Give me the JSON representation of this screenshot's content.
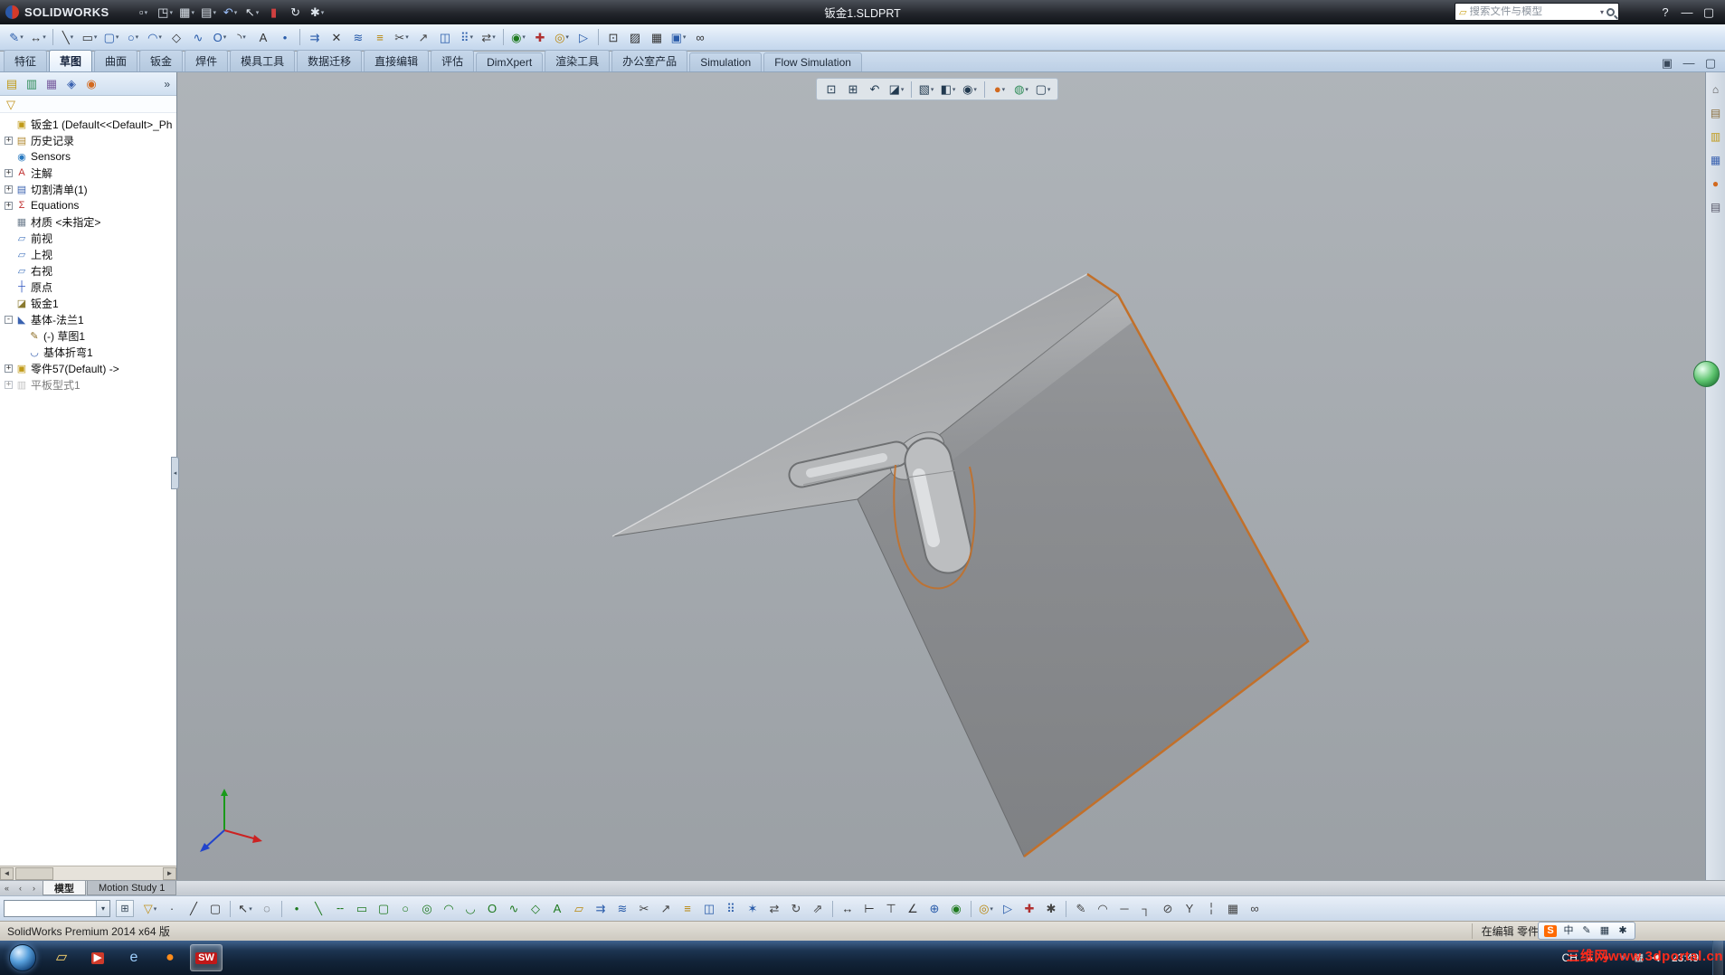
{
  "colors": {
    "selection_edge_orange": "#c2702a",
    "viewport_background": "#a6abb0",
    "taskbar_blue": "#1d3552",
    "watermark_red": "#ff2a1a",
    "active_tab_background": "#eef5fc"
  },
  "titlebar": {
    "brand": "SOLIDWORKS",
    "title": "钣金1.SLDPRT",
    "search_placeholder": "搜索文件与模型",
    "search_scope_glyph": "▱",
    "search_arrow": "▾",
    "tools": [
      {
        "n": "new-document-button",
        "g": "▫",
        "c": "#dfe6ee",
        "dd": 1
      },
      {
        "n": "open-button",
        "g": "◳",
        "c": "#dfe6ee",
        "dd": 1
      },
      {
        "n": "save-button",
        "g": "▦",
        "c": "#dfe6ee",
        "dd": 1
      },
      {
        "n": "print-button",
        "g": "▤",
        "c": "#dfe6ee",
        "dd": 1
      },
      {
        "n": "undo-button",
        "g": "↶",
        "c": "#9fc3ff",
        "dd": 1
      },
      {
        "n": "select-button",
        "g": "↖",
        "c": "#dfe6ee",
        "dd": 1
      },
      {
        "n": "file-properties-button",
        "g": "▮",
        "c": "#d04040"
      },
      {
        "n": "rebuild-button",
        "g": "↻",
        "c": "#dfe6ee"
      },
      {
        "n": "options-button",
        "g": "✱",
        "c": "#dfe6ee",
        "dd": 1
      }
    ],
    "window_buttons": [
      {
        "n": "help-button",
        "g": "?",
        "c": "#e8ecf2"
      },
      {
        "n": "minimize-button",
        "g": "—",
        "c": "#e8ecf2"
      },
      {
        "n": "restore-button",
        "g": "▢",
        "c": "#e8ecf2"
      }
    ]
  },
  "toolbars": {
    "sketch": [
      {
        "n": "sketch-button",
        "g": "✎",
        "c": "#2a5caa",
        "dd": 1
      },
      {
        "n": "smart-dimension-button",
        "g": "↔",
        "c": "#333",
        "dd": 1
      },
      {
        "sep": 1
      },
      {
        "n": "line-tool",
        "g": "╲",
        "c": "#333",
        "dd": 1
      },
      {
        "n": "rectangle-tool",
        "g": "▭",
        "c": "#333",
        "dd": 1
      },
      {
        "n": "slot-tool",
        "g": "▢",
        "c": "#2a5caa",
        "dd": 1
      },
      {
        "n": "circle-tool",
        "g": "○",
        "c": "#2a5caa",
        "dd": 1
      },
      {
        "n": "arc-tool",
        "g": "◠",
        "c": "#2a5caa",
        "dd": 1
      },
      {
        "n": "polygon-tool",
        "g": "◇",
        "c": "#333"
      },
      {
        "n": "spline-tool",
        "g": "∿",
        "c": "#2a5caa"
      },
      {
        "n": "ellipse-tool",
        "g": "O",
        "c": "#2a5caa",
        "dd": 1
      },
      {
        "n": "fillet-tool",
        "g": "◝",
        "c": "#333",
        "dd": 1
      },
      {
        "n": "text-tool",
        "g": "A",
        "c": "#333"
      },
      {
        "n": "point-tool",
        "g": "•",
        "c": "#2a5caa"
      },
      {
        "sep": 1
      },
      {
        "n": "convert-entities-button",
        "g": "⇉",
        "c": "#2a5caa"
      },
      {
        "n": "intersection-curve-button",
        "g": "✕",
        "c": "#333"
      },
      {
        "n": "face-curves-button",
        "g": "≋",
        "c": "#2a5caa"
      },
      {
        "n": "offset-entities-button",
        "g": "≡",
        "c": "#b8860b"
      },
      {
        "n": "trim-entities-button",
        "g": "✂",
        "c": "#444",
        "dd": 1
      },
      {
        "n": "extend-entities-button",
        "g": "↗",
        "c": "#444"
      },
      {
        "n": "mirror-entities-button",
        "g": "◫",
        "c": "#2a5caa"
      },
      {
        "n": "linear-sketch-pattern-button",
        "g": "⠿",
        "c": "#2a5caa",
        "dd": 1
      },
      {
        "n": "move-entities-button",
        "g": "⇄",
        "c": "#444",
        "dd": 1
      },
      {
        "sep": 1
      },
      {
        "n": "display-delete-relations-button",
        "g": "◉",
        "c": "#1f7a1f",
        "dd": 1
      },
      {
        "n": "repair-sketch-button",
        "g": "✚",
        "c": "#b03030"
      },
      {
        "n": "quick-snaps-button",
        "g": "◎",
        "c": "#b8860b",
        "dd": 1
      },
      {
        "n": "rapid-sketch-button",
        "g": "▷",
        "c": "#2a5caa"
      },
      {
        "sep": 1
      },
      {
        "n": "instant2d-button",
        "g": "⊡",
        "c": "#333"
      },
      {
        "n": "shaded-sketch-contours-button",
        "g": "▨",
        "c": "#333"
      },
      {
        "n": "sketch-picture-button",
        "g": "▦",
        "c": "#333"
      },
      {
        "n": "make-block-button",
        "g": "▣",
        "c": "#2a5caa",
        "dd": 1
      },
      {
        "n": "belt-chain-button",
        "g": "∞",
        "c": "#333"
      }
    ],
    "heads_up": [
      {
        "n": "zoom-to-fit-button",
        "g": "⊡",
        "c": "#223a50"
      },
      {
        "n": "zoom-to-area-button",
        "g": "⊞",
        "c": "#223a50"
      },
      {
        "n": "previous-view-button",
        "g": "↶",
        "c": "#223a50"
      },
      {
        "n": "section-view-button",
        "g": "◪",
        "c": "#223a50",
        "dd": 1
      },
      {
        "sep": 1
      },
      {
        "n": "view-orientation-button",
        "g": "▧",
        "c": "#223a50",
        "dd": 1
      },
      {
        "n": "display-style-button",
        "g": "◧",
        "c": "#223a50",
        "dd": 1
      },
      {
        "n": "hide-show-items-button",
        "g": "◉",
        "c": "#223a50",
        "dd": 1
      },
      {
        "sep": 1
      },
      {
        "n": "edit-appearance-button",
        "g": "●",
        "c": "#d2691e",
        "dd": 1
      },
      {
        "n": "apply-scene-button",
        "g": "◍",
        "c": "#2e8b57",
        "dd": 1
      },
      {
        "n": "view-settings-button",
        "g": "▢",
        "c": "#223a50",
        "dd": 1
      }
    ],
    "cmd_right": [
      {
        "n": "pin-commandmanager-button",
        "g": "▣",
        "c": "#3a4a5c"
      },
      {
        "n": "document-minimize-button",
        "g": "—",
        "c": "#3a4a5c"
      },
      {
        "n": "document-restore-button",
        "g": "▢",
        "c": "#3a4a5c"
      }
    ],
    "task_pane": [
      {
        "n": "solidworks-resources-icon",
        "g": "⌂",
        "c": "#555"
      },
      {
        "n": "design-library-icon",
        "g": "▤",
        "c": "#8a6d3b"
      },
      {
        "n": "file-explorer-icon",
        "g": "▥",
        "c": "#c09a18"
      },
      {
        "n": "view-palette-icon",
        "g": "▦",
        "c": "#3a62b0"
      },
      {
        "n": "appearances-icon",
        "g": "●",
        "c": "#d2691e"
      },
      {
        "n": "custom-properties-icon",
        "g": "▤",
        "c": "#556"
      }
    ]
  },
  "command_tabs": [
    {
      "label": "特征",
      "n": "tab-features"
    },
    {
      "label": "草图",
      "n": "tab-sketch",
      "active": 1
    },
    {
      "label": "曲面",
      "n": "tab-surfaces"
    },
    {
      "label": "钣金",
      "n": "tab-sheet-metal"
    },
    {
      "label": "焊件",
      "n": "tab-weldments"
    },
    {
      "label": "模具工具",
      "n": "tab-mold-tools"
    },
    {
      "label": "数据迁移",
      "n": "tab-data-migration"
    },
    {
      "label": "直接编辑",
      "n": "tab-direct-editing"
    },
    {
      "label": "评估",
      "n": "tab-evaluate"
    },
    {
      "label": "DimXpert",
      "n": "tab-dimxpert"
    },
    {
      "label": "渲染工具",
      "n": "tab-render-tools"
    },
    {
      "label": "办公室产品",
      "n": "tab-office-products"
    },
    {
      "label": "Simulation",
      "n": "tab-simulation"
    },
    {
      "label": "Flow Simulation",
      "n": "tab-flow-simulation"
    }
  ],
  "panel": {
    "tabs": [
      {
        "n": "featuremanager-tab",
        "g": "▤",
        "c": "#c09a18"
      },
      {
        "n": "propertymanager-tab",
        "g": "▥",
        "c": "#2e8b57"
      },
      {
        "n": "configurationmanager-tab",
        "g": "▦",
        "c": "#7a5fa0"
      },
      {
        "n": "dimxpertmanager-tab",
        "g": "◈",
        "c": "#3a62b0"
      },
      {
        "n": "displaymanager-tab",
        "g": "◉",
        "c": "#d2691e"
      }
    ],
    "more_glyph": "»",
    "filter": [
      {
        "n": "tree-filter-icon",
        "g": "▽",
        "c": "#c09018"
      }
    ],
    "hscroll_left": "◄",
    "hscroll_right": "►",
    "collapse_glyph": "◂"
  },
  "feature_tree": {
    "items": [
      {
        "n": "tree-root-part",
        "icon": "▣",
        "icon_color": "#c09a18",
        "label": "钣金1 (Default<<Default>_Ph"
      },
      {
        "n": "tree-item-history",
        "expand": "+",
        "icon": "▤",
        "icon_color": "#b08830",
        "label": "历史记录"
      },
      {
        "n": "tree-item-sensors",
        "icon": "◉",
        "icon_color": "#2a7ac0",
        "label": "Sensors"
      },
      {
        "n": "tree-item-annotations",
        "expand": "+",
        "icon": "A",
        "icon_color": "#c03030",
        "label": "注解"
      },
      {
        "n": "tree-item-cutlist",
        "expand": "+",
        "icon": "▤",
        "icon_color": "#3a62b0",
        "label": "切割清单(1)"
      },
      {
        "n": "tree-item-equations",
        "expand": "+",
        "icon": "Σ",
        "icon_color": "#c03030",
        "label": "Equations"
      },
      {
        "n": "tree-item-material",
        "icon": "▦",
        "icon_color": "#708090",
        "label": "材质 <未指定>"
      },
      {
        "n": "tree-item-front-plane",
        "icon": "▱",
        "icon_color": "#4a7ac0",
        "label": "前视"
      },
      {
        "n": "tree-item-top-plane",
        "icon": "▱",
        "icon_color": "#4a7ac0",
        "label": "上视"
      },
      {
        "n": "tree-item-right-plane",
        "icon": "▱",
        "icon_color": "#4a7ac0",
        "label": "右视"
      },
      {
        "n": "tree-item-origin",
        "icon": "┼",
        "icon_color": "#2a52be",
        "label": "原点"
      },
      {
        "n": "tree-item-sheet-metal",
        "icon": "◪",
        "icon_color": "#8a7a30",
        "label": "钣金1"
      },
      {
        "n": "tree-item-base-flange",
        "expand": "-",
        "icon": "◣",
        "icon_color": "#3a62b0",
        "label": "基体-法兰1"
      },
      {
        "n": "tree-item-sketch1",
        "indent": 1,
        "icon": "✎",
        "icon_color": "#8a6a20",
        "label": "(-) 草图1"
      },
      {
        "n": "tree-item-base-bend",
        "indent": 1,
        "icon": "◡",
        "icon_color": "#3a62b0",
        "label": "基体折弯1"
      },
      {
        "n": "tree-item-part57",
        "expand": "+",
        "icon": "▣",
        "icon_color": "#c09a18",
        "label": "零件57(Default) ->"
      },
      {
        "n": "tree-item-flat-pattern",
        "expand": "+",
        "icon": "▥",
        "icon_color": "#909090",
        "label": "平板型式1",
        "grayed": 1
      }
    ]
  },
  "bottom_tabs": {
    "scroll_buttons": [
      {
        "n": "tabs-scroll-start-button",
        "g": "«",
        "c": "#444"
      },
      {
        "n": "tabs-scroll-left-button",
        "g": "‹",
        "c": "#444"
      },
      {
        "n": "tabs-scroll-right-button",
        "g": "›",
        "c": "#444"
      }
    ],
    "tabs": [
      {
        "label": "模型",
        "n": "tab-model",
        "active": 1
      },
      {
        "label": "Motion Study 1",
        "n": "tab-motion-study-1"
      }
    ]
  },
  "bottom_toolbar": {
    "combo_value": "",
    "combo_arrow": "▾",
    "expand_glyph": "⊞",
    "icons": [
      {
        "n": "selection-filter-button",
        "g": "▽",
        "c": "#c09018",
        "dd": 1
      },
      {
        "n": "filter-vertices-button",
        "g": "·",
        "c": "#333"
      },
      {
        "n": "filter-edges-button",
        "g": "╱",
        "c": "#333"
      },
      {
        "n": "filter-faces-button",
        "g": "▢",
        "c": "#333"
      },
      {
        "sep": 1
      },
      {
        "n": "select-arrow-button",
        "g": "↖",
        "c": "#333",
        "dd": 1
      },
      {
        "n": "lasso-select-button",
        "g": "◌",
        "c": "#333"
      },
      {
        "sep": 1
      },
      {
        "n": "sketch-point-tool",
        "g": "•",
        "c": "#1f7a1f"
      },
      {
        "n": "sketch-line-tool",
        "g": "╲",
        "c": "#1f7a1f"
      },
      {
        "n": "sketch-centerline-tool",
        "g": "╌",
        "c": "#1f7a1f"
      },
      {
        "n": "sketch-rectangle-tool",
        "g": "▭",
        "c": "#1f7a1f"
      },
      {
        "n": "sketch-center-rectangle-tool",
        "g": "▢",
        "c": "#1f7a1f"
      },
      {
        "n": "sketch-circle-tool",
        "g": "○",
        "c": "#1f7a1f"
      },
      {
        "n": "sketch-perimeter-circle-tool",
        "g": "◎",
        "c": "#1f7a1f"
      },
      {
        "n": "sketch-arc-tool",
        "g": "◠",
        "c": "#1f7a1f"
      },
      {
        "n": "sketch-tangent-arc-tool",
        "g": "◡",
        "c": "#1f7a1f"
      },
      {
        "n": "sketch-ellipse-tool",
        "g": "O",
        "c": "#1f7a1f"
      },
      {
        "n": "sketch-spline-tool",
        "g": "∿",
        "c": "#1f7a1f"
      },
      {
        "n": "sketch-polygon-tool",
        "g": "◇",
        "c": "#1f7a1f"
      },
      {
        "n": "sketch-text-tool",
        "g": "A",
        "c": "#1f7a1f"
      },
      {
        "n": "sketch-plane-tool",
        "g": "▱",
        "c": "#b8860b"
      },
      {
        "n": "convert-entities-button",
        "g": "⇉",
        "c": "#2a5caa"
      },
      {
        "n": "face-curves-button",
        "g": "≋",
        "c": "#2a5caa"
      },
      {
        "n": "trim-entities-button",
        "g": "✂",
        "c": "#444"
      },
      {
        "n": "extend-entities-button",
        "g": "↗",
        "c": "#444"
      },
      {
        "n": "offset-entities-button",
        "g": "≡",
        "c": "#b8860b"
      },
      {
        "n": "mirror-entities-button",
        "g": "◫",
        "c": "#2a5caa"
      },
      {
        "n": "linear-sketch-pattern-button",
        "g": "⠿",
        "c": "#2a5caa"
      },
      {
        "n": "circular-sketch-pattern-button",
        "g": "✶",
        "c": "#2a5caa"
      },
      {
        "n": "move-entities-button",
        "g": "⇄",
        "c": "#444"
      },
      {
        "n": "rotate-entities-button",
        "g": "↻",
        "c": "#444"
      },
      {
        "n": "scale-entities-button",
        "g": "⇗",
        "c": "#444"
      },
      {
        "sep": 1
      },
      {
        "n": "smart-dimension-button",
        "g": "↔",
        "c": "#333"
      },
      {
        "n": "horizontal-dimension-button",
        "g": "⊢",
        "c": "#333"
      },
      {
        "n": "vertical-dimension-button",
        "g": "⊤",
        "c": "#333"
      },
      {
        "n": "angle-dimension-button",
        "g": "∠",
        "c": "#333"
      },
      {
        "n": "add-relation-button",
        "g": "⊕",
        "c": "#2a5caa"
      },
      {
        "n": "display-relations-button",
        "g": "◉",
        "c": "#1f7a1f"
      },
      {
        "sep": 1
      },
      {
        "n": "quick-snaps-button",
        "g": "◎",
        "c": "#b8860b",
        "dd": 1
      },
      {
        "n": "rapid-sketch-button",
        "g": "▷",
        "c": "#2a5caa"
      },
      {
        "n": "repair-sketch-button",
        "g": "✚",
        "c": "#b03030"
      },
      {
        "n": "modify-sketch-button",
        "g": "✱",
        "c": "#444"
      },
      {
        "sep": 1
      },
      {
        "n": "pen-tool",
        "g": "✎",
        "c": "#444"
      },
      {
        "n": "arc-segment-tool",
        "g": "◠",
        "c": "#444"
      },
      {
        "n": "line-segment-tool",
        "g": "─",
        "c": "#444"
      },
      {
        "n": "corner-tool",
        "g": "┐",
        "c": "#444"
      },
      {
        "n": "erase-ink-tool",
        "g": "⊘",
        "c": "#444"
      },
      {
        "n": "split-entities-tool",
        "g": "Y",
        "c": "#444"
      },
      {
        "n": "construction-geometry-button",
        "g": "╎",
        "c": "#444"
      },
      {
        "n": "grid-snap-button",
        "g": "▦",
        "c": "#444"
      },
      {
        "n": "chain-tool",
        "g": "∞",
        "c": "#444"
      }
    ]
  },
  "status_bar": {
    "left": "SolidWorks Premium 2014 x64 版",
    "editing": "在编辑 零件"
  },
  "sogou_bar": [
    {
      "n": "sogou-logo-icon",
      "g": "S",
      "bg": "#ff6a00",
      "c": "#fff"
    },
    {
      "n": "sogou-mode-chinese",
      "g": "中",
      "c": "#234"
    },
    {
      "n": "sogou-pen-icon",
      "g": "✎",
      "c": "#234"
    },
    {
      "n": "sogou-keyboard-icon",
      "g": "▦",
      "c": "#234"
    },
    {
      "n": "sogou-settings-icon",
      "g": "✱",
      "c": "#234"
    }
  ],
  "taskbar": {
    "lang": "CH",
    "time": "23:49",
    "apps": [
      {
        "n": "taskbar-explorer-button",
        "g": "▱",
        "c": "#ffd76e"
      },
      {
        "n": "taskbar-media-player-button",
        "g": "▶",
        "c": "#fff",
        "bg": "#cf3a2a"
      },
      {
        "n": "taskbar-internet-explorer-button",
        "g": "e",
        "c": "#9fd0ff"
      },
      {
        "n": "taskbar-firefox-button",
        "g": "●",
        "c": "#ff8c1a"
      },
      {
        "n": "taskbar-solidworks-button",
        "g": "SW",
        "c": "#fff",
        "bg": "#c01818",
        "active": 1
      }
    ],
    "tray": [
      {
        "n": "tray-expand-button",
        "g": "▴",
        "c": "#e8e8e8"
      },
      {
        "n": "tray-app-icon-1",
        "g": "●",
        "c": "#e04040"
      },
      {
        "n": "tray-app-icon-2",
        "g": "●",
        "c": "#40a0e0"
      },
      {
        "n": "tray-network-icon",
        "g": "▦",
        "c": "#e8e8e8"
      },
      {
        "n": "tray-volume-icon",
        "g": "◀",
        "c": "#e8e8e8"
      }
    ]
  },
  "watermark": "三维网www.3dportal.cn"
}
